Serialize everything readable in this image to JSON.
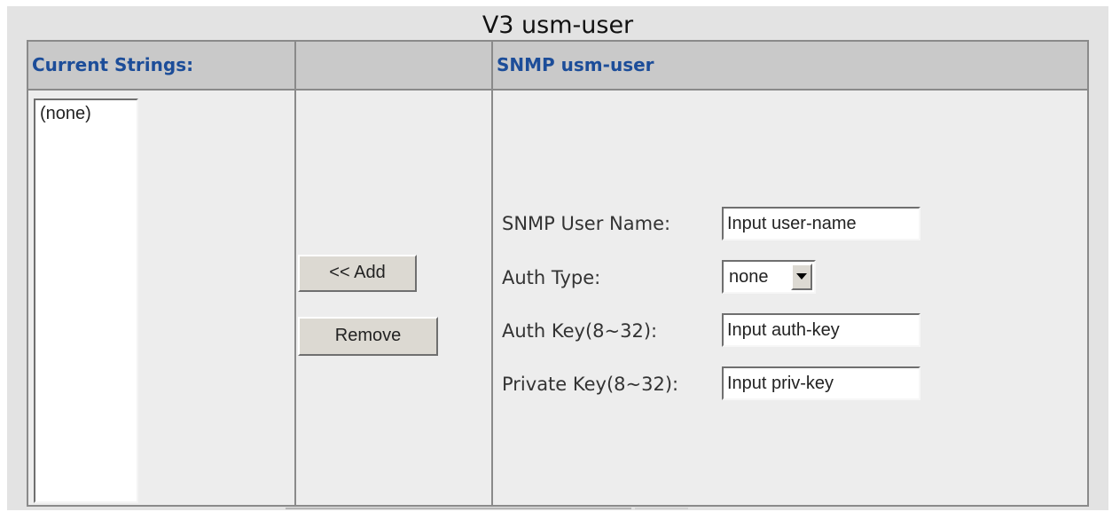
{
  "page": {
    "title": "V3 usm-user"
  },
  "header": {
    "current_strings": "Current Strings:",
    "middle": "",
    "snmp_usm_user": "SNMP usm-user"
  },
  "list": {
    "items": [
      "(none)"
    ]
  },
  "buttons": {
    "add": "<< Add",
    "remove": "Remove"
  },
  "form": {
    "user_name_label": "SNMP User Name:",
    "user_name_value": "Input user-name",
    "auth_type_label": "Auth Type:",
    "auth_type_selected": "none",
    "auth_key_label": "Auth Key(8~32):",
    "auth_key_value": "Input auth-key",
    "priv_key_label": "Private Key(8~32):",
    "priv_key_value": "Input priv-key"
  },
  "colors": {
    "header_text": "#1c4d99",
    "panel_bg": "#e3e3e3",
    "header_bg": "#c9c9c9"
  }
}
